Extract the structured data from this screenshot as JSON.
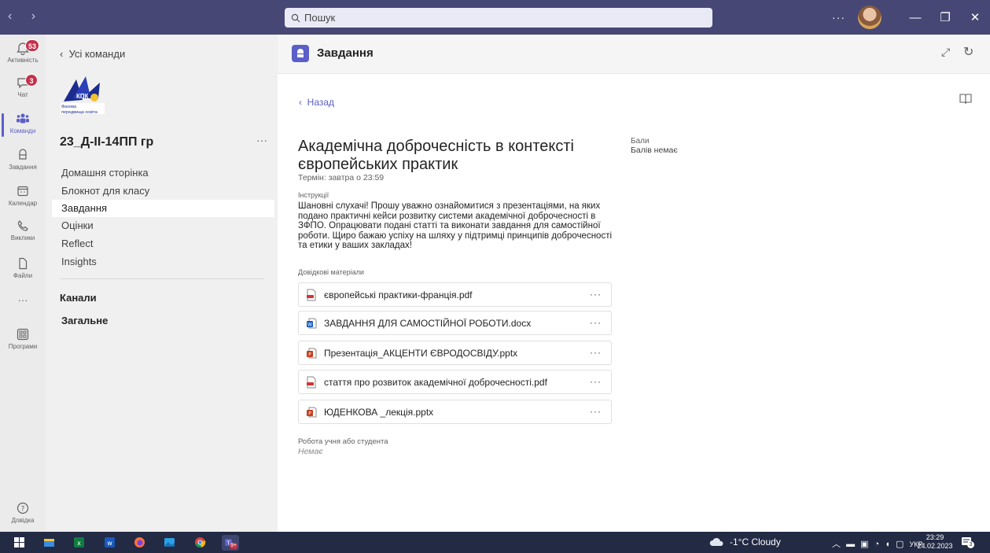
{
  "titlebar": {
    "search_placeholder": "Пошук",
    "more": "···",
    "minimize": "—",
    "maximize": "❐",
    "close": "✕"
  },
  "rail": [
    {
      "label": "Активність",
      "icon": "bell-icon",
      "badge": "53"
    },
    {
      "label": "Чат",
      "icon": "chat-icon",
      "badge": "3"
    },
    {
      "label": "Команди",
      "icon": "teams-icon",
      "badge": null
    },
    {
      "label": "Завдання",
      "icon": "assignments-icon",
      "badge": null
    },
    {
      "label": "Календар",
      "icon": "calendar-icon",
      "badge": null
    },
    {
      "label": "Виклики",
      "icon": "phone-icon",
      "badge": null
    },
    {
      "label": "Файли",
      "icon": "file-icon",
      "badge": null
    },
    {
      "label": "···",
      "icon": "more-icon",
      "badge": null
    },
    {
      "label": "Програми",
      "icon": "apps-icon",
      "badge": null
    }
  ],
  "help_label": "Довідка",
  "team_panel": {
    "back_label": "Усі команди",
    "logo_text": "КПК",
    "logo_sub": "Фахова передвища освіта",
    "team_name": "23_Д-ІІ-14ПП гр",
    "more": "···",
    "nav": [
      "Домашня сторінка",
      "Блокнот для класу",
      "Завдання",
      "Оцінки",
      "Reflect",
      "Insights"
    ],
    "channels_label": "Канали",
    "channel_general": "Загальне"
  },
  "main": {
    "app_title": "Завдання",
    "back_label": "Назад",
    "assignment_title": "Академічна доброчесність в контексті європейських практик",
    "due": "Термін: завтра о 23:59",
    "instructions_label": "Інструкції",
    "instructions": "Шановні слухачі! Прошу уважно ознайомитися з презентаціями, на яких подано практичні  кейси розвитку системи академічної доброчесності в ЗФПО. Опрацювати подані статті та виконати завдання для самостійної роботи. Щиро бажаю успіху на шляху у підтримці принципів доброчесності та етики у ваших закладах!",
    "points_label": "Бали",
    "points_value": "Балів немає",
    "reference_label": "Довідкові матеріали",
    "files": [
      {
        "name": "європейські практики-франція.pdf",
        "type": "pdf"
      },
      {
        "name": "ЗАВДАННЯ ДЛЯ САМОСТІЙНОЇ РОБОТИ.docx",
        "type": "docx"
      },
      {
        "name": "Презентація_АКЦЕНТИ ЄВРОДОСВІДУ.pptx",
        "type": "pptx"
      },
      {
        "name": "стаття про розвиток академічної доброчесності.pdf",
        "type": "pdf"
      },
      {
        "name": "ЮДЕНКОВА _лекція.pptx",
        "type": "pptx"
      }
    ],
    "file_more": "···",
    "work_label": "Робота учня або студента",
    "work_value": "Немає"
  },
  "taskbar": {
    "weather": "-1°C  Cloudy",
    "tray_lang": "УКР",
    "time": "23:29",
    "date": "24.02.2023",
    "notif_count": "3",
    "teams_badge": "9+"
  },
  "colors": {
    "accent": "#5b5fc7",
    "titlebar": "#464775",
    "taskbar": "#222a44",
    "badge": "#c4314b"
  }
}
